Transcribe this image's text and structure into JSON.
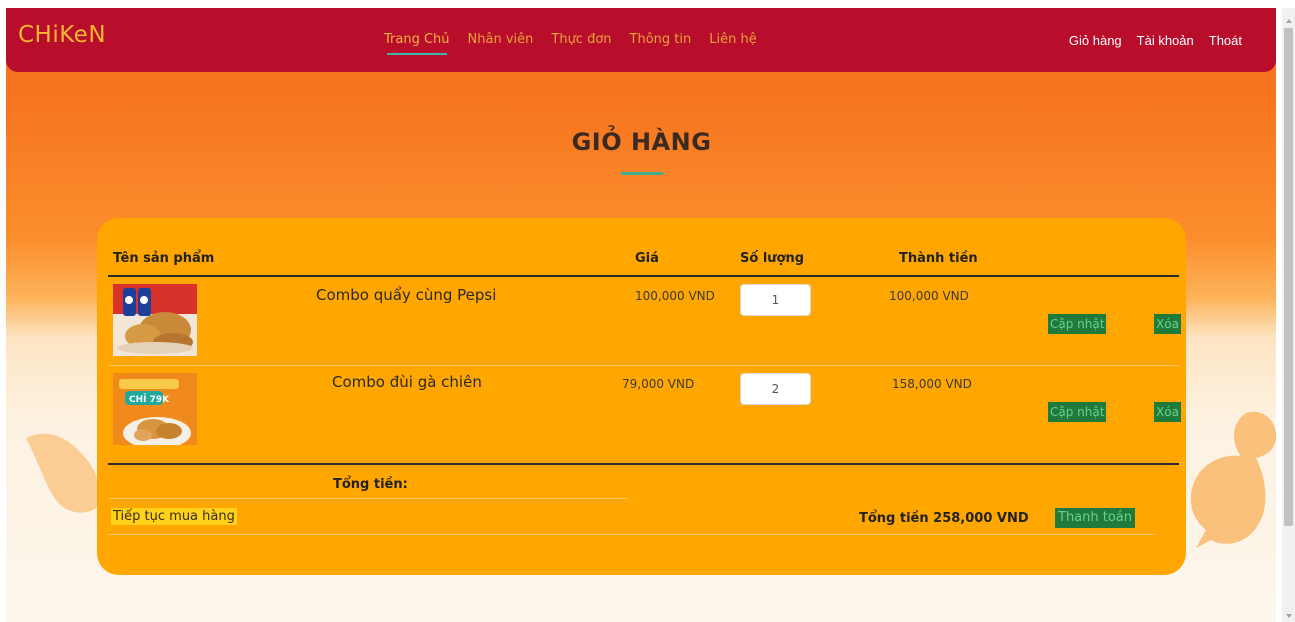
{
  "brand": "CHiKeN",
  "nav": {
    "center": [
      "Trang Chủ",
      "Nhân viên",
      "Thực đơn",
      "Thông tin",
      "Liên hệ"
    ],
    "right": [
      "Giỏ hàng",
      "Tài khoản",
      "Thoát"
    ]
  },
  "page_title": "GIỎ HÀNG",
  "table": {
    "headers": {
      "product": "Tên sản phẩm",
      "price": "Giá",
      "qty": "Số lượng",
      "subtotal": "Thành tiền"
    },
    "rows": [
      {
        "name": "Combo quẩy cùng Pepsi",
        "price": "100,000 VND",
        "qty": "1",
        "subtotal": "100,000 VND",
        "update": "Cập nhật",
        "delete": "Xóa"
      },
      {
        "name": "Combo đùi gà chiên",
        "price": "79,000 VND",
        "qty": "2",
        "subtotal": "158,000 VND",
        "update": "Cập nhật",
        "delete": "Xóa"
      }
    ]
  },
  "footer": {
    "total_label": "Tổng tiền:",
    "continue": "Tiếp tục mua hàng",
    "grand_total": "Tổng tiền 258,000 VND",
    "checkout": "Thanh toán"
  },
  "colors": {
    "navbar": "#b80d2b",
    "brand": "#f7b531",
    "card": "#ffa600",
    "button": "#1f7a3c",
    "accent_underline": "#3fae8f"
  }
}
